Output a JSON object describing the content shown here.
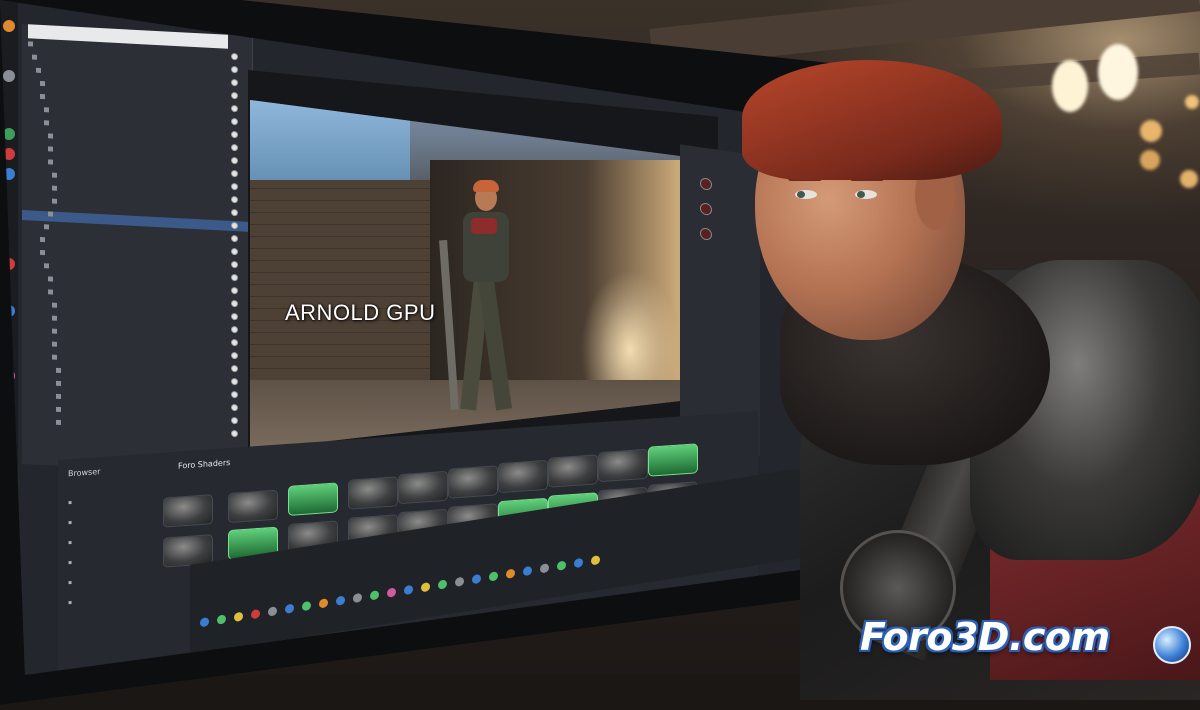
{
  "scene": {
    "overlay_title": "ARNOLD GPU",
    "watermark": "Foro3D.com",
    "asset_browser_title": "Browser",
    "asset_browser_tab": "Foro Shaders"
  },
  "outliner": {
    "rows": [
      "",
      "",
      "",
      "",
      "",
      "",
      "",
      "",
      "",
      "",
      "",
      "",
      "",
      "",
      "",
      "",
      "",
      "",
      "",
      "",
      "",
      "",
      "",
      "",
      "",
      "",
      "",
      "",
      "",
      ""
    ]
  },
  "colors": {
    "accent_blue": "#2d5fb5",
    "selection": "#3b5a8a",
    "highlight_green": "#5fcf7a"
  }
}
